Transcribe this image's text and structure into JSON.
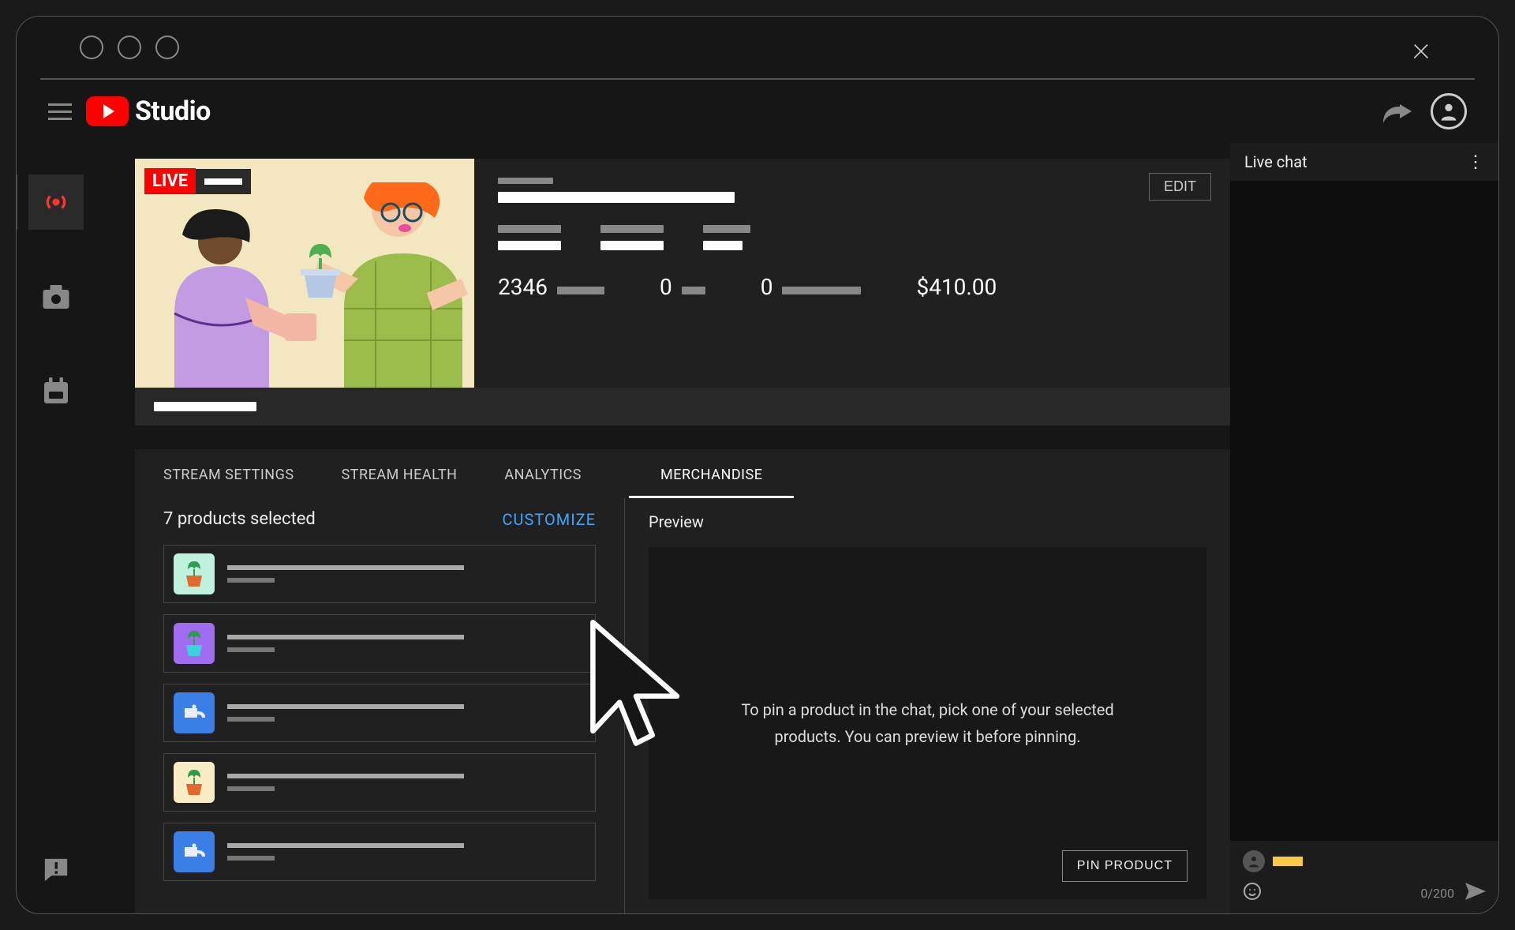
{
  "appbar": {
    "logo_text": "Studio"
  },
  "stream": {
    "live_label": "LIVE",
    "edit_label": "EDIT"
  },
  "metrics": {
    "m1": "2346",
    "m2": "0",
    "m3": "0",
    "m4": "$410.00"
  },
  "tabs": {
    "t1": "STREAM SETTINGS",
    "t2": "STREAM HEALTH",
    "t3": "ANALYTICS",
    "t4": "MERCHANDISE"
  },
  "merchandise": {
    "selected_text": "7 products selected",
    "customize_label": "CUSTOMIZE",
    "preview_label": "Preview",
    "pin_hint": "To pin a product in the chat, pick one of your selected products. You can preview it before pinning.",
    "pin_button": "PIN PRODUCT",
    "products": [
      {
        "bg": "#bff1dc",
        "icon": "plant-orange"
      },
      {
        "bg": "#a06cf0",
        "icon": "plant-blue"
      },
      {
        "bg": "#3b7fe6",
        "icon": "watering-can"
      },
      {
        "bg": "#f9edc5",
        "icon": "plant-orange"
      },
      {
        "bg": "#3b7fe6",
        "icon": "watering-can"
      }
    ]
  },
  "chat": {
    "title": "Live chat",
    "counter": "0/200"
  }
}
